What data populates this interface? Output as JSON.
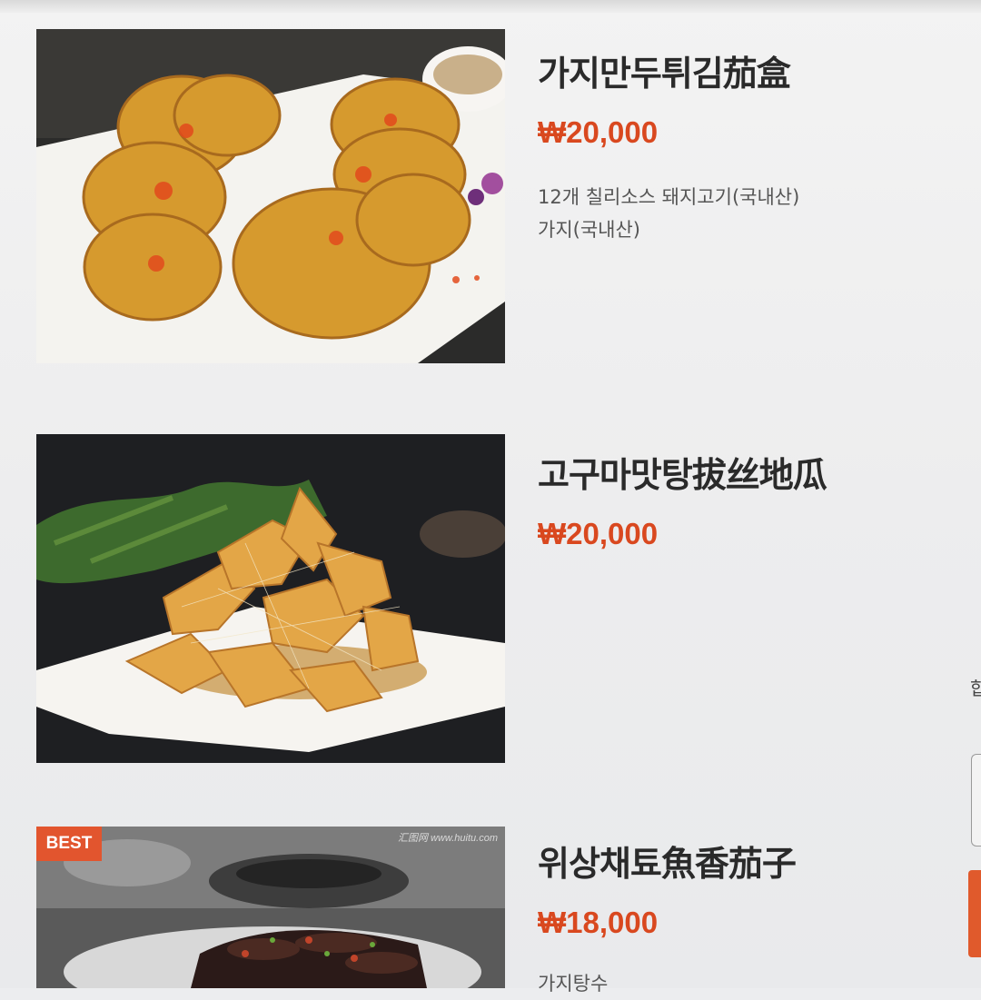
{
  "colors": {
    "accent": "#d9481f",
    "badge": "#e2552e",
    "text": "#2a2a2a"
  },
  "menu": [
    {
      "name": "가지만두튀김茄盒",
      "price": "₩20,000",
      "description": "12개 칠리소스 돼지고기(국내산)\n가지(국내산)",
      "photo_icon": "fried-eggplant-image"
    },
    {
      "name": "고구마맛탕拔丝地瓜",
      "price": "₩20,000",
      "description": "",
      "photo_icon": "candied-sweet-potato-image"
    },
    {
      "name": "위상채툐魚香茄子",
      "price": "₩18,000",
      "description": "가지탕수",
      "badge": "BEST",
      "watermark": "汇图网 www.huitu.com",
      "photo_icon": "yuxiang-eggplant-image"
    }
  ],
  "edge_glyph": "합"
}
